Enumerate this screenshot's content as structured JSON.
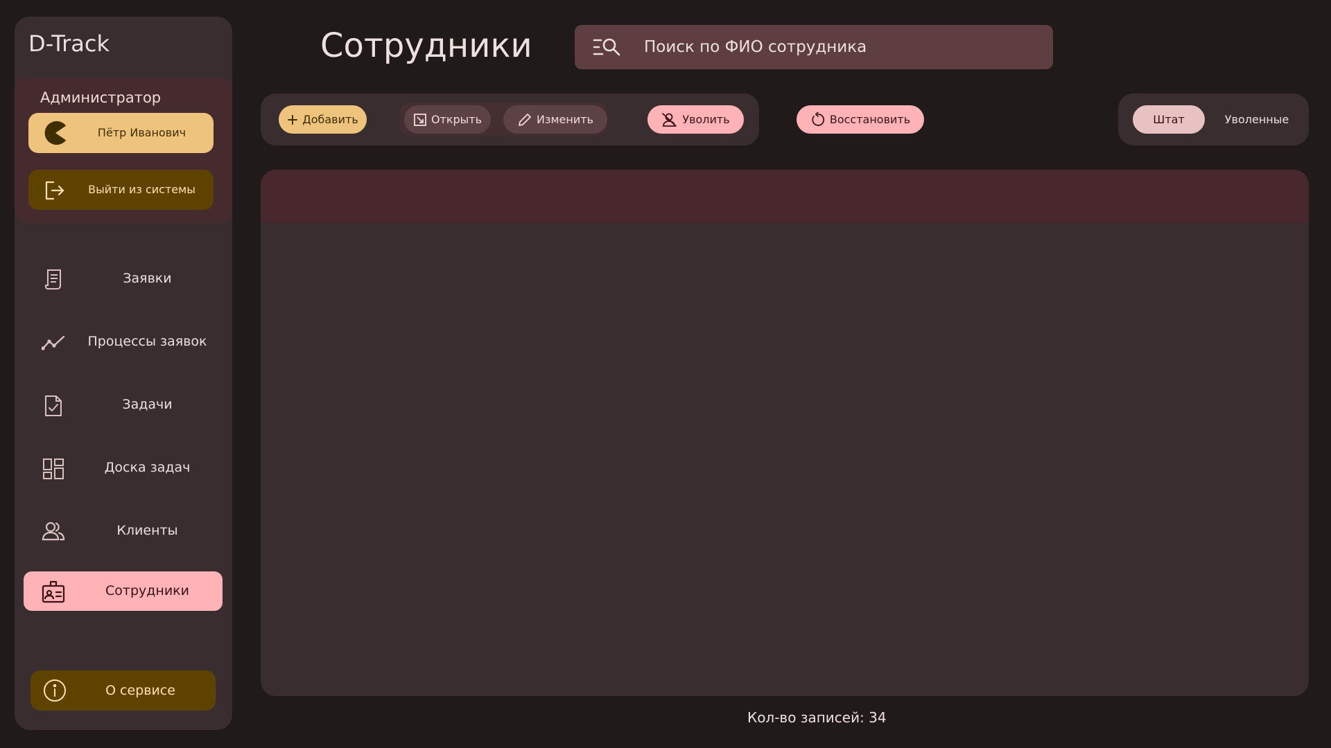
{
  "app": {
    "title": "D-Track"
  },
  "user": {
    "role": "Администратор",
    "name": "Пётр Иванович",
    "logout_label": "Выйти из системы"
  },
  "nav": {
    "items": [
      {
        "label": "Заявки",
        "icon": "requests-icon"
      },
      {
        "label": "Процессы заявок",
        "icon": "processes-icon"
      },
      {
        "label": "Задачи",
        "icon": "tasks-icon"
      },
      {
        "label": "Доска задач",
        "icon": "board-icon"
      },
      {
        "label": "Клиенты",
        "icon": "clients-icon"
      },
      {
        "label": "Сотрудники",
        "icon": "employees-icon",
        "active": true
      }
    ],
    "about_label": "О сервисе"
  },
  "page": {
    "title": "Сотрудники"
  },
  "search": {
    "placeholder": "Поиск по ФИО сотрудника",
    "value": ""
  },
  "toolbar": {
    "add_label": "Добавить",
    "open_label": "Открыть",
    "edit_label": "Изменить",
    "fire_label": "Уволить",
    "restore_label": "Восстановить"
  },
  "filter": {
    "staff_label": "Штат",
    "fired_label": "Уволенные",
    "selected": "Штат"
  },
  "footer": {
    "count_text": "Кол-во записей: 34"
  },
  "colors": {
    "background": "#201a1b",
    "surface": "#3a2d2f",
    "accent_pink": "#ffb3b7",
    "accent_yellow": "#eec37d",
    "accent_dark_yellow": "#5e4200"
  }
}
